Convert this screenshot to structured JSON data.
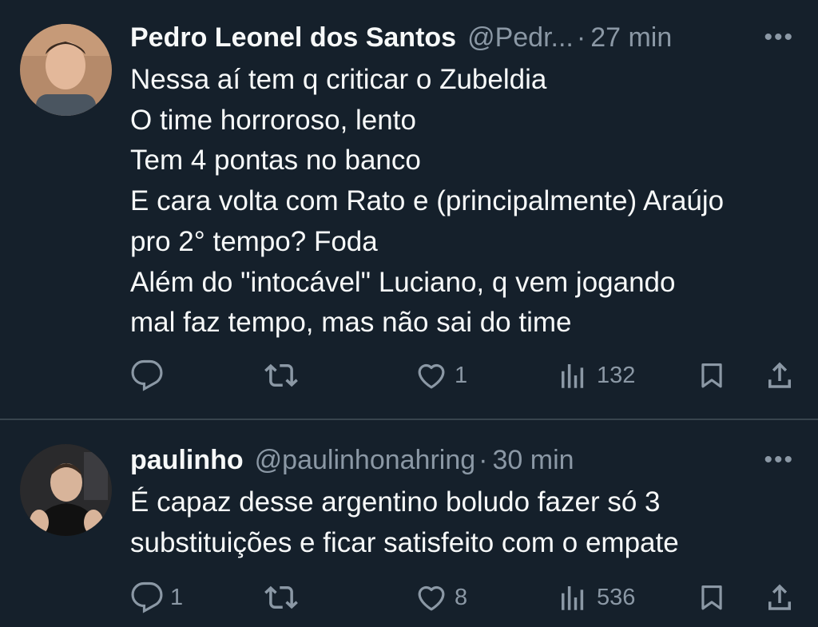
{
  "tweets": [
    {
      "author_name": "Pedro Leonel dos Santos",
      "handle": "@Pedr...",
      "separator": "·",
      "time": "27 min",
      "more": "•••",
      "text_lines": [
        "Nessa aí tem q criticar o Zubeldia",
        "O time horroroso, lento",
        "Tem 4 pontas no banco",
        "E cara volta com Rato e (principalmente) Araújo",
        "pro 2° tempo? Foda",
        "Além do \"intocável\" Luciano, q vem jogando",
        "mal faz tempo, mas não sai do time"
      ],
      "actions": {
        "reply_count": "",
        "retweet_count": "",
        "like_count": "1",
        "views_count": "132"
      }
    },
    {
      "author_name": "paulinho",
      "handle": "@paulinhonahring",
      "separator": "·",
      "time": "30 min",
      "more": "•••",
      "text_lines": [
        "É capaz desse argentino boludo fazer só 3",
        "substituições e ficar satisfeito com o empate"
      ],
      "actions": {
        "reply_count": "1",
        "retweet_count": "",
        "like_count": "8",
        "views_count": "536"
      }
    }
  ],
  "colors": {
    "background": "#15202b",
    "text": "#f7f9f9",
    "secondary": "#8b98a5",
    "divider": "#38444d"
  },
  "icons": [
    "reply-icon",
    "retweet-icon",
    "like-icon",
    "views-icon",
    "bookmark-icon",
    "share-icon",
    "more-icon"
  ]
}
